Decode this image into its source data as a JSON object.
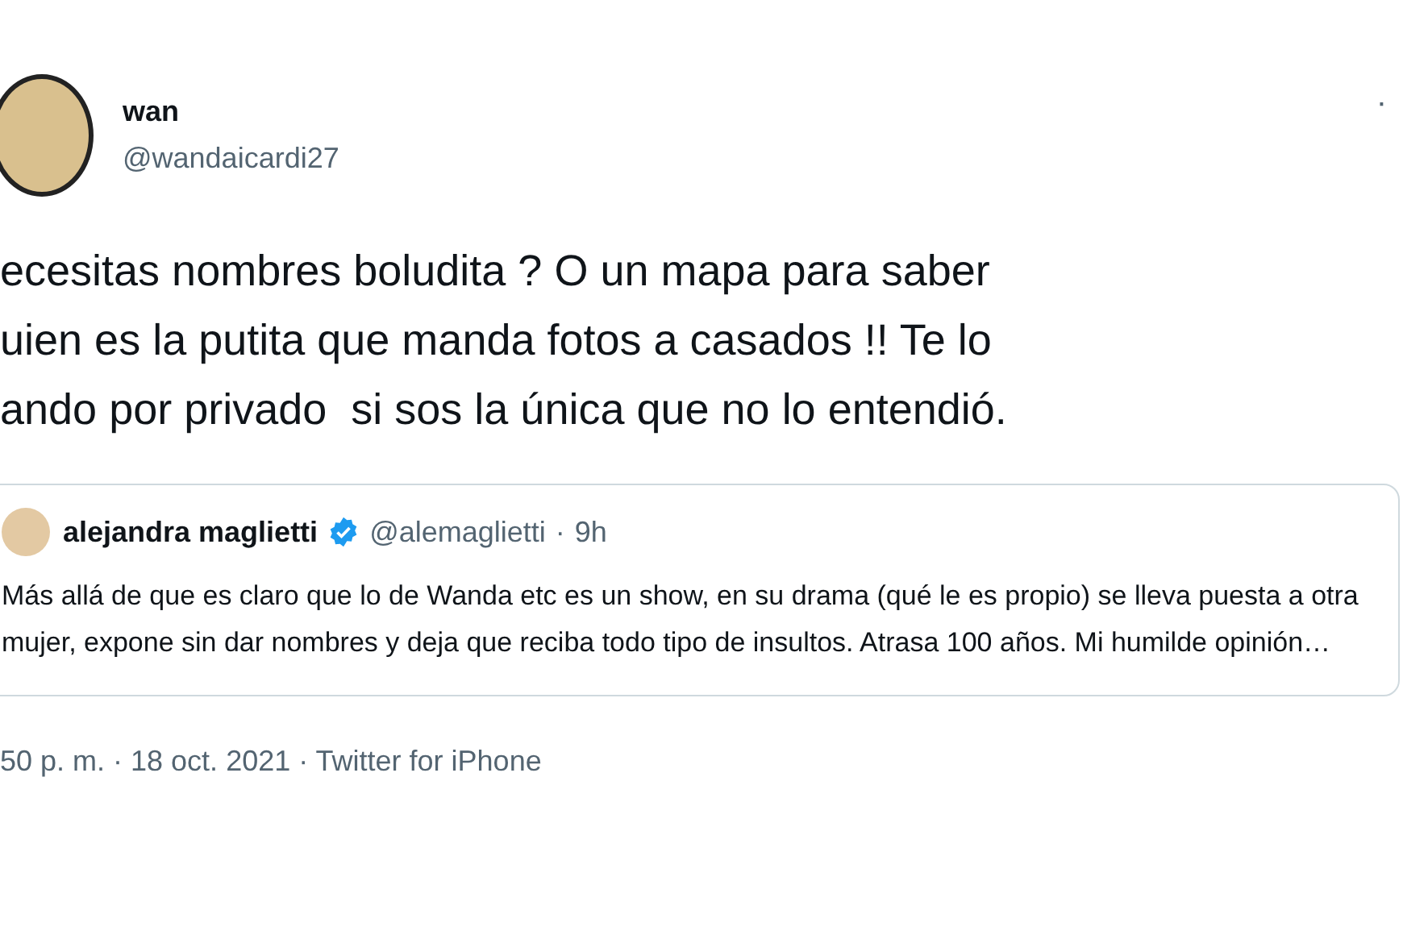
{
  "tweet": {
    "name": "wan",
    "handle": "@wandaicardi27",
    "more": "·",
    "text_lines": [
      "ecesitas nombres boludita ? O un mapa para saber",
      "uien es la putita que manda fotos a casados !! Te lo",
      "ando por privado  si sos la única que no lo entendió."
    ],
    "quote": {
      "name": "alejandra maglietti",
      "verified": true,
      "handle": "@alemaglietti",
      "separator": "·",
      "time": "9h",
      "text": "Más allá de que es claro que lo de Wanda etc es un show, en su drama (qué le es propio) se lleva puesta a otra mujer, expone sin dar nombres y deja que reciba todo tipo de insultos. Atrasa 100 años. Mi humilde opinión…"
    },
    "footer": "50 p. m. · 18 oct. 2021 · Twitter for iPhone"
  }
}
